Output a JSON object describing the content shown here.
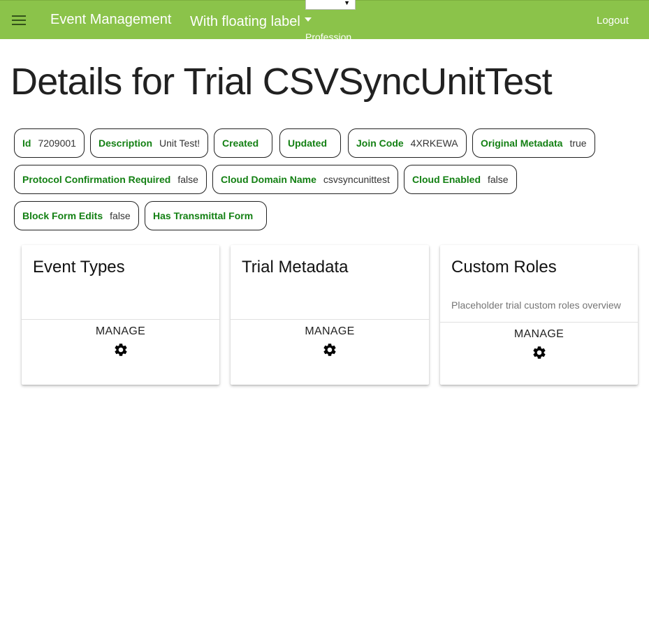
{
  "header": {
    "menu_icon": "hamburger-menu-icon",
    "app_title": "Event Management",
    "floating_select_label": "With floating label",
    "profession_label": "Profession",
    "logout_label": "Logout",
    "colors": {
      "bar": "#8bc34a",
      "bar_text": "#ffffff"
    }
  },
  "page": {
    "title": "Details for Trial CSVSyncUnitTest"
  },
  "details": {
    "accent_color": "#138013",
    "items": [
      {
        "label": "Id",
        "value": "7209001"
      },
      {
        "label": "Description",
        "value": "Unit Test!"
      },
      {
        "label": "Created",
        "value": ""
      },
      {
        "label": "Updated",
        "value": ""
      },
      {
        "label": "Join Code",
        "value": "4XRKEWA"
      },
      {
        "label": "Original Metadata",
        "value": "true"
      },
      {
        "label": "Protocol Confirmation Required",
        "value": "false"
      },
      {
        "label": "Cloud Domain Name",
        "value": "csvsyncunittest"
      },
      {
        "label": "Cloud Enabled",
        "value": "false"
      },
      {
        "label": "Block Form Edits",
        "value": "false"
      },
      {
        "label": "Has Transmittal Form",
        "value": ""
      }
    ]
  },
  "cards": [
    {
      "title": "Event Types",
      "subtitle": "",
      "action_label": "MANAGE",
      "action_icon": "gear-icon"
    },
    {
      "title": "Trial Metadata",
      "subtitle": "",
      "action_label": "MANAGE",
      "action_icon": "gear-icon"
    },
    {
      "title": "Custom Roles",
      "subtitle": "Placeholder trial custom roles overview",
      "action_label": "MANAGE",
      "action_icon": "gear-icon"
    }
  ]
}
